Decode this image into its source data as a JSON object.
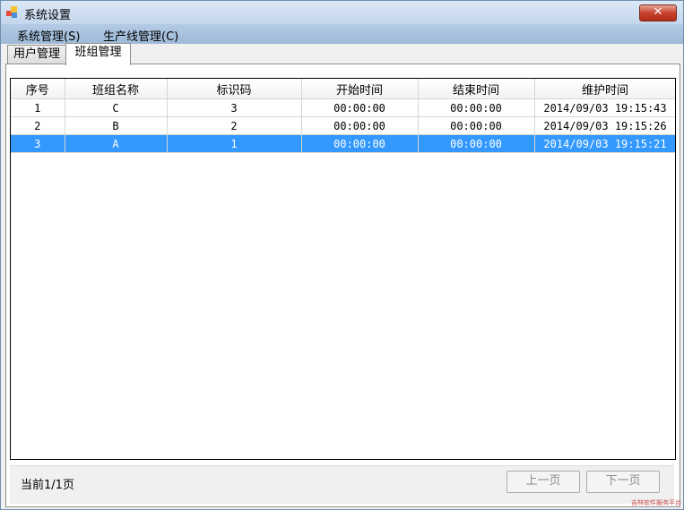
{
  "window": {
    "title": "系统设置",
    "close_label": "✕"
  },
  "menubar": {
    "items": [
      "系统管理(S)",
      "生产线管理(C)"
    ]
  },
  "tabs": [
    {
      "label": "用户管理",
      "active": false
    },
    {
      "label": "班组管理",
      "active": true
    }
  ],
  "grid": {
    "columns": [
      "序号",
      "班组名称",
      "标识码",
      "开始时间",
      "结束时间",
      "维护时间"
    ],
    "rows": [
      [
        "1",
        "C",
        "3",
        "00:00:00",
        "00:00:00",
        "2014/09/03 19:15:43"
      ],
      [
        "2",
        "B",
        "2",
        "00:00:00",
        "00:00:00",
        "2014/09/03 19:15:26"
      ],
      [
        "3",
        "A",
        "1",
        "00:00:00",
        "00:00:00",
        "2014/09/03 19:15:21"
      ]
    ],
    "selected_row": 2,
    "selection_color": "#3399ff"
  },
  "footer": {
    "page_info": "当前1/1页",
    "prev_label": "上一页",
    "next_label": "下一页"
  },
  "watermark": "吉林软件服务平台"
}
